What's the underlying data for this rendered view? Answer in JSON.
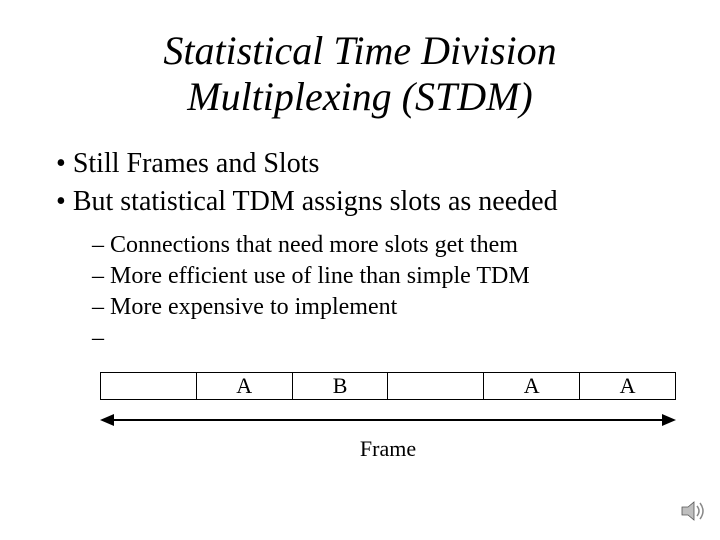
{
  "title_line1": "Statistical Time Division",
  "title_line2": "Multiplexing (STDM)",
  "bullets": {
    "b1": "Still Frames and Slots",
    "b2": "But statistical TDM assigns slots as needed"
  },
  "subs": {
    "s1": "Connections that need more slots get them",
    "s2": "More efficient use of line than simple TDM",
    "s3": "More expensive to implement"
  },
  "frame": {
    "slots": {
      "c0": "",
      "c1": "A",
      "c2": "B",
      "c3": "",
      "c4": "A",
      "c5": "A"
    },
    "label": "Frame"
  },
  "icons": {
    "speaker": "speaker-icon"
  }
}
